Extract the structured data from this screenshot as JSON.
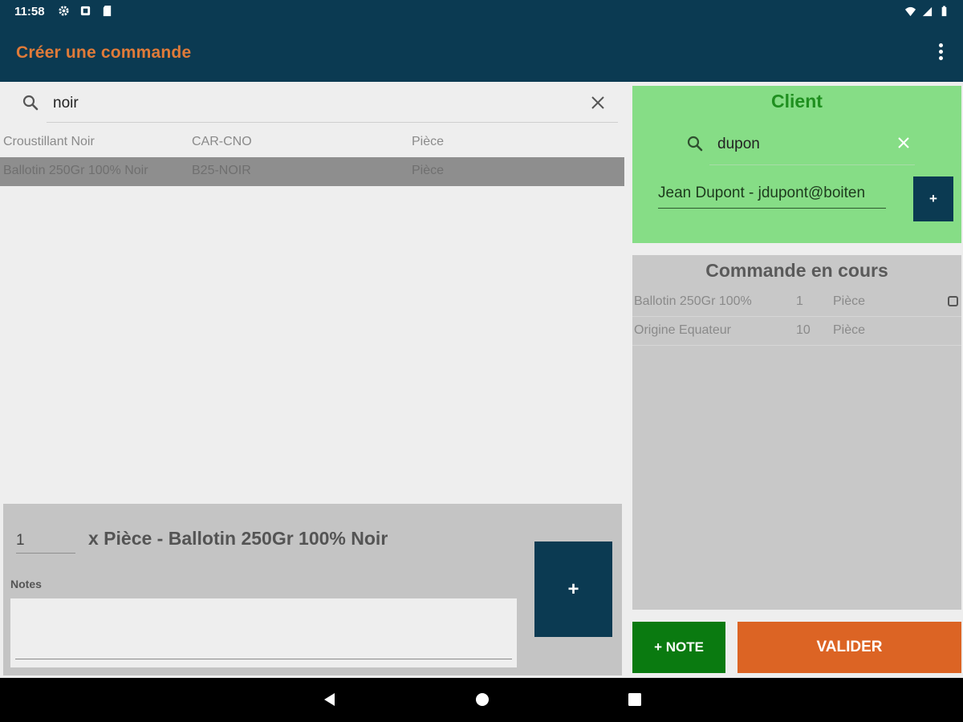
{
  "status_bar": {
    "time": "11:58",
    "left_icons": [
      "gear-icon",
      "notification-icon",
      "sd-card-icon"
    ],
    "right_icons": [
      "wifi-icon",
      "signal-icon",
      "battery-icon"
    ]
  },
  "app_bar": {
    "title": "Créer une commande",
    "menu_icon": "overflow-menu-icon"
  },
  "product_search": {
    "value": "noir",
    "icon": "search-icon",
    "clear_icon": "close-icon"
  },
  "products": [
    {
      "name": "Croustillant Noir",
      "code": "CAR-CNO",
      "unit": "Pièce",
      "selected": false
    },
    {
      "name": "Ballotin 250Gr 100% Noir",
      "code": "B25-NOIR",
      "unit": "Pièce",
      "selected": true
    }
  ],
  "add_panel": {
    "quantity": "1",
    "summary": "x Pièce - Ballotin 250Gr 100% Noir",
    "notes_label": "Notes",
    "notes_value": "",
    "add_button_label": "+"
  },
  "client": {
    "title": "Client",
    "search_value": "dupon",
    "selected_client": "Jean Dupont - jdupont@boiten",
    "add_button_label": "+"
  },
  "order": {
    "title": "Commande en cours",
    "lines": [
      {
        "name": "Ballotin 250Gr 100%",
        "qty": "1",
        "unit": "Pièce"
      },
      {
        "name": "Origine Equateur",
        "qty": "10",
        "unit": "Pièce"
      }
    ]
  },
  "actions": {
    "note_label": "+ NOTE",
    "validate_label": "VALIDER"
  },
  "colors": {
    "primary_dark": "#0b3a52",
    "accent_orange": "#e07b39",
    "client_green": "#86dd86",
    "note_green": "#0a7a10",
    "validate_orange": "#dc6424"
  }
}
